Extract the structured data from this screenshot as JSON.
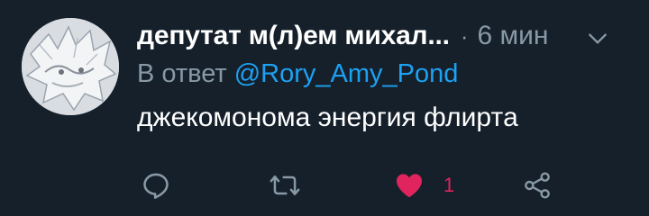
{
  "tweet": {
    "display_name": "депутат м(л)ем михал...",
    "separator": "·",
    "time": "6 мин",
    "reply_prefix": "В ответ",
    "reply_handle": "@Rory_Amy_Pond",
    "text": "джекомонома энергия флиртa",
    "actions": {
      "reply_icon": "reply-icon",
      "retweet_icon": "retweet-icon",
      "like_icon": "heart-icon",
      "share_icon": "share-icon",
      "like_count": "1",
      "liked": true
    }
  },
  "colors": {
    "background": "#15202b",
    "primary_text": "#ffffff",
    "secondary_text": "#8899a6",
    "link": "#1da1f2",
    "like": "#e0245e",
    "icon": "#8899a6"
  }
}
